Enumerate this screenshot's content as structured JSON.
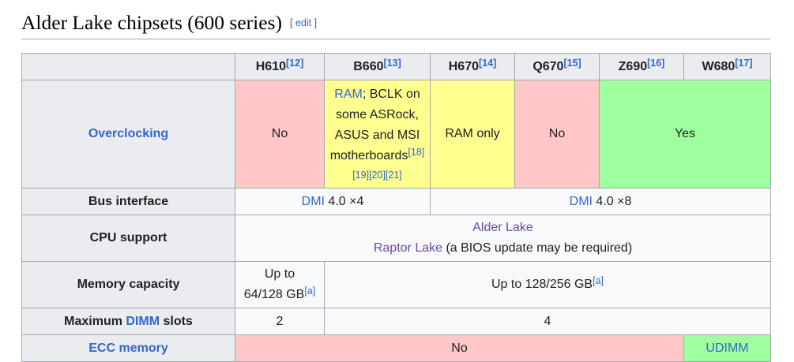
{
  "heading": {
    "title": "Alder Lake chipsets (600 series)",
    "edit_open": "[",
    "edit_label": "edit",
    "edit_close": "]"
  },
  "columns": [
    {
      "name": "H610",
      "ref": "[12]"
    },
    {
      "name": "B660",
      "ref": "[13]"
    },
    {
      "name": "H670",
      "ref": "[14]"
    },
    {
      "name": "Q670",
      "ref": "[15]"
    },
    {
      "name": "Z690",
      "ref": "[16]"
    },
    {
      "name": "W680",
      "ref": "[17]"
    }
  ],
  "rows": {
    "overclocking": {
      "label": "Overclocking",
      "h610": "No",
      "b660_link": "RAM",
      "b660_text": "; BCLK on some ASRock, ASUS and MSI motherboards",
      "b660_ref1": "[18]",
      "b660_refs": [
        "[19]",
        "[20]",
        "[21]"
      ],
      "h670": "RAM only",
      "q670": "No",
      "z690_w680": "Yes"
    },
    "bus": {
      "label": "Bus interface",
      "left_link": "DMI",
      "left_text": " 4.0 ×4",
      "right_link": "DMI",
      "right_text": " 4.0 ×8"
    },
    "cpu": {
      "label": "CPU support",
      "line1_link": "Alder Lake",
      "line2_link": "Raptor Lake",
      "line2_text": " (a BIOS update may be required)"
    },
    "memory": {
      "label": "Memory capacity",
      "h610_line1": "Up to",
      "h610_line2": "64/128 GB",
      "h610_ref": "[a]",
      "rest": "Up to 128/256 GB",
      "rest_ref": "[a]"
    },
    "dimm": {
      "label_pre": "Maximum ",
      "label_link": "DIMM",
      "label_post": " slots",
      "h610": "2",
      "rest": "4"
    },
    "ecc": {
      "label": "ECC memory",
      "no": "No",
      "w680": "UDIMM"
    }
  },
  "colors": {
    "no": "#ffc7c7",
    "partial": "#ffff90",
    "yes": "#9eff9e",
    "link": "#3366cc",
    "visited": "#6b4ba1"
  }
}
